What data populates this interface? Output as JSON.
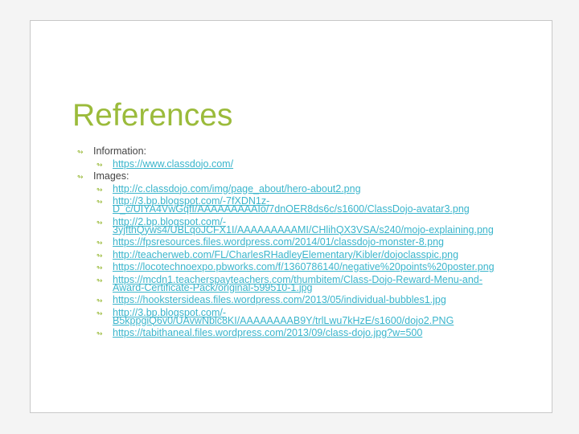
{
  "title": "References",
  "sections": [
    {
      "label": "Information:",
      "links": [
        "https://www.classdojo.com/"
      ]
    },
    {
      "label": "Images:",
      "links": [
        "http://c.classdojo.com/img/page_about/hero-about2.png",
        "http://3.bp.blogspot.com/-7fXDN1z-D_c/UIYA4VwGqfI/AAAAAAAAAIo/7dnOER8ds6c/s1600/ClassDojo-avatar3.png",
        "http://2.bp.blogspot.com/-3yjfthQyws4/UBLqoJCFX1I/AAAAAAAAAMI/CHlihQX3VSA/s240/mojo-explaining.png",
        "https://fpsresources.files.wordpress.com/2014/01/classdojo-monster-8.png",
        "http://teacherweb.com/FL/CharlesRHadleyElementary/Kibler/dojoclasspic.png",
        "https://locotechnoexpo.pbworks.com/f/1360786140/negative%20points%20poster.png",
        "https://mcdn1.teacherspayteachers.com/thumbitem/Class-Dojo-Reward-Menu-and-Award-Certificate-Pack/original-599510-1.jpg",
        "https://hookstersideas.files.wordpress.com/2013/05/individual-bubbles1.jpg",
        "http://3.bp.blogspot.com/-B5kppgiQ6v0/UAvwNblc8KI/AAAAAAAAB9Y/trlLwu7kHzE/s1600/dojo2.PNG",
        "https://tabithaneal.files.wordpress.com/2013/09/class-dojo.jpg?w=500"
      ]
    }
  ]
}
